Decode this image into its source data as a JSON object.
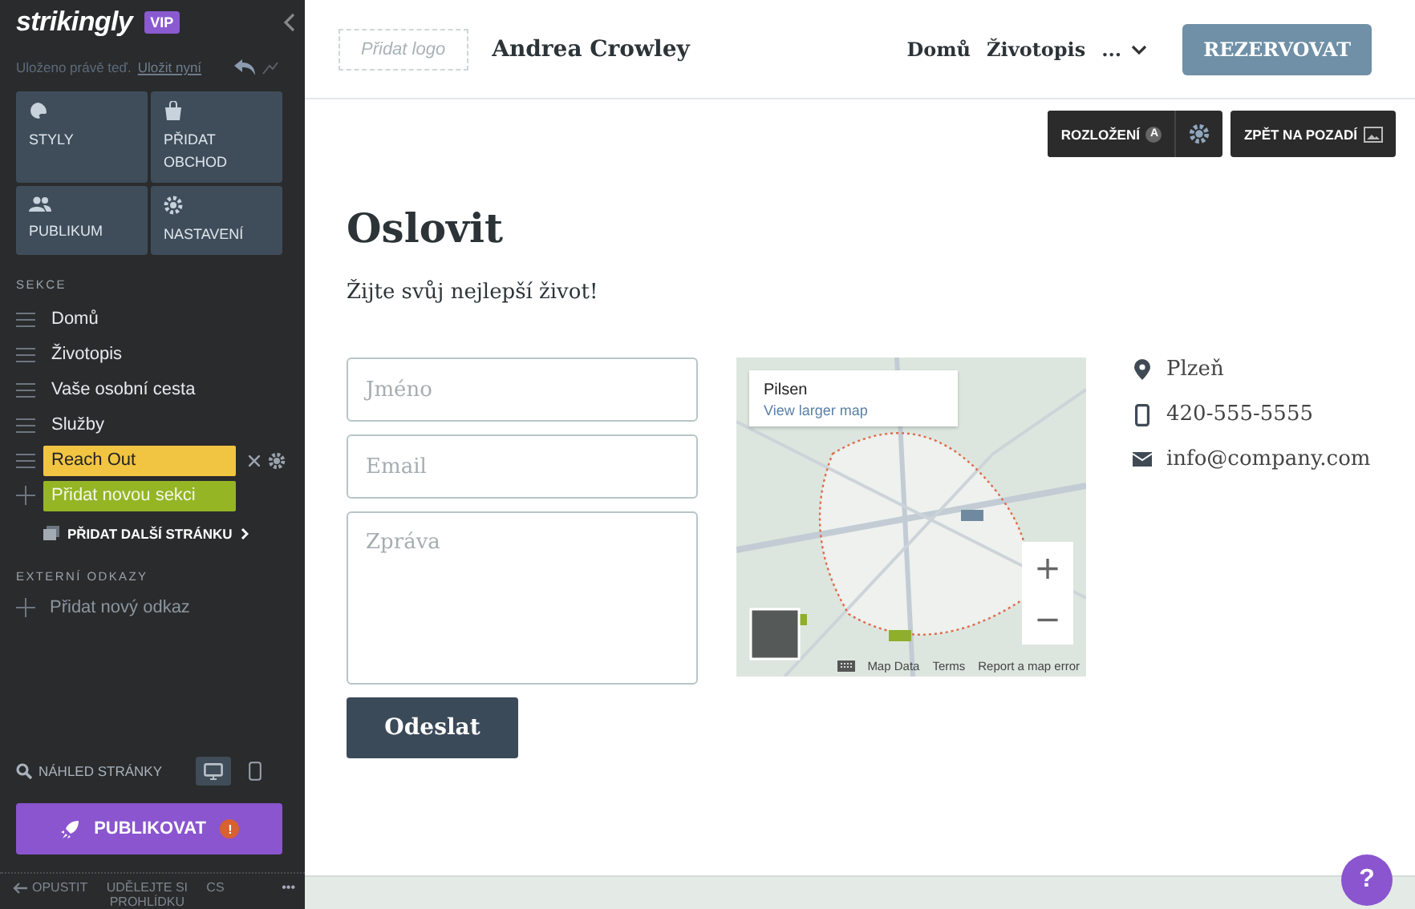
{
  "sidebar": {
    "logo": "strikingly",
    "badge": "VIP",
    "save_status": "Uloženo právě teď.",
    "save_link": "Uložit nyní",
    "tiles": [
      {
        "kind": "styles",
        "label": "STYLY"
      },
      {
        "kind": "store",
        "label": "PŘIDAT OBCHOD"
      },
      {
        "kind": "audience",
        "label": "PUBLIKUM"
      },
      {
        "kind": "settings",
        "label": "NASTAVENÍ"
      }
    ],
    "sections_heading": "SEKCE",
    "sections": [
      {
        "label": "Domů",
        "selected": false
      },
      {
        "label": "Životopis",
        "selected": false
      },
      {
        "label": "Vaše osobní cesta",
        "selected": false
      },
      {
        "label": "Služby",
        "selected": false
      },
      {
        "label": "Reach Out",
        "selected": true
      }
    ],
    "add_section": "Přidat novou sekci",
    "add_page": "PŘIDAT DALŠÍ STRÁNKU",
    "external_heading": "EXTERNÍ ODKAZY",
    "add_link": "Přidat nový odkaz",
    "preview": "NÁHLED STRÁNKY",
    "devices": [
      {
        "kind": "desktop",
        "selected": true
      },
      {
        "kind": "mobile",
        "selected": false
      }
    ],
    "publish": "PUBLIKOVAT",
    "publish_warning": "!",
    "footer": {
      "exit": "OPUSTIT",
      "tour": "UDĚLEJTE SI PROHLÍDKU",
      "language": "CS",
      "more": "•••"
    }
  },
  "header": {
    "logo_placeholder": "Přidat logo",
    "site_title": "Andrea Crowley",
    "nav": [
      {
        "label": "Domů"
      },
      {
        "label": "Životopis"
      }
    ],
    "nav_more": "...",
    "cta": "REZERVOVAT"
  },
  "section_toolbar": {
    "layout": "ROZLOŽENÍ",
    "layout_badge": "A",
    "background": "ZPĚT NA POZADÍ"
  },
  "content": {
    "title": "Oslovit",
    "subtitle": "Žijte svůj nejlepší život!",
    "form": {
      "fields": [
        {
          "kind": "input",
          "placeholder": "Jméno"
        },
        {
          "kind": "input",
          "placeholder": "Email"
        },
        {
          "kind": "textarea",
          "placeholder": "Zpráva"
        }
      ],
      "submit": "Odeslat"
    },
    "map": {
      "popup_title": "Pilsen",
      "popup_link": "View larger map",
      "zoom_in": "+",
      "zoom_out": "−",
      "attribution": [
        "Map Data",
        "Terms",
        "Report a map error"
      ]
    },
    "contact": [
      {
        "kind": "location",
        "text": "Plzeň"
      },
      {
        "kind": "phone",
        "text": "420-555-5555"
      },
      {
        "kind": "email",
        "text": "info@company.com"
      }
    ]
  },
  "help": "?"
}
